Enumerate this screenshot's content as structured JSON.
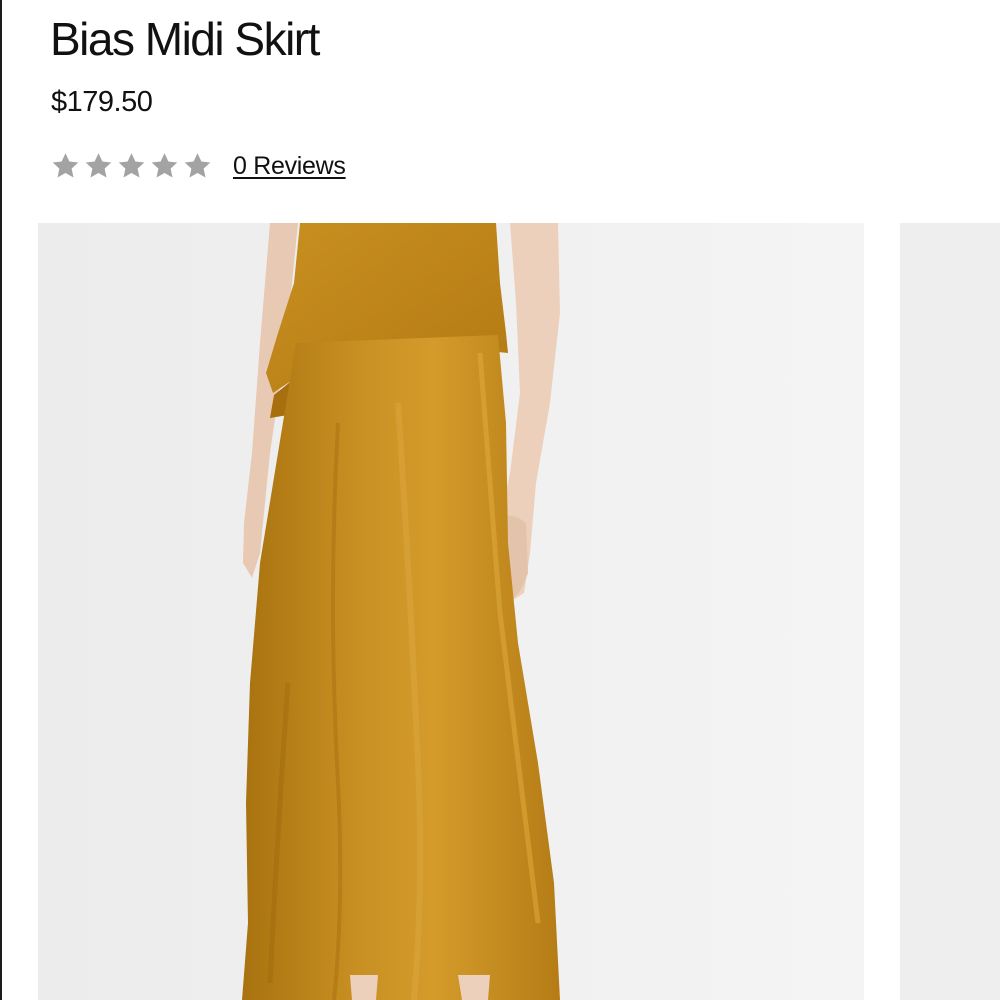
{
  "product": {
    "title": "Bias Midi Skirt",
    "price": "$179.50",
    "rating": {
      "stars": 0,
      "max_stars": 5,
      "reviews_label": "0 Reviews",
      "star_color": "#a3a3a3"
    }
  },
  "gallery": {
    "main_image_icon": "product-photo-skirt-mustard",
    "garment_color": "#c08a1f",
    "background_color": "#efefef"
  }
}
